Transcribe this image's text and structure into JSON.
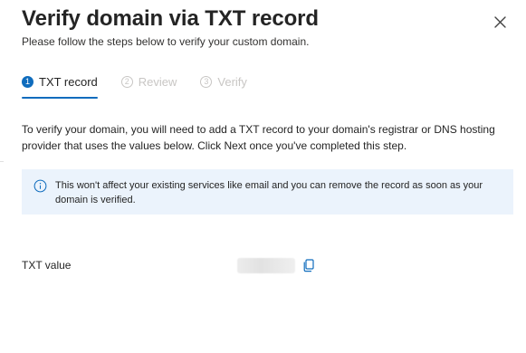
{
  "dialog": {
    "title": "Verify domain via TXT record",
    "subtitle": "Please follow the steps below to verify your custom domain."
  },
  "steps": [
    {
      "number": "1",
      "label": "TXT record",
      "state": "active"
    },
    {
      "number": "2",
      "label": "Review",
      "state": "inactive"
    },
    {
      "number": "3",
      "label": "Verify",
      "state": "inactive"
    }
  ],
  "description": "To verify your domain, you will need to add a TXT record to your domain's registrar or DNS hosting provider that uses the values below. Click Next once you've completed this step.",
  "info": {
    "icon": "info-icon",
    "text": "This won't affect your existing services like email and you can remove the record as soon as your domain is verified."
  },
  "txt": {
    "label": "TXT value",
    "copy_icon": "copy-icon"
  },
  "colors": {
    "accent": "#0f6cbd",
    "info_background": "#ebf3fc",
    "inactive_step": "#c8c6c4"
  }
}
